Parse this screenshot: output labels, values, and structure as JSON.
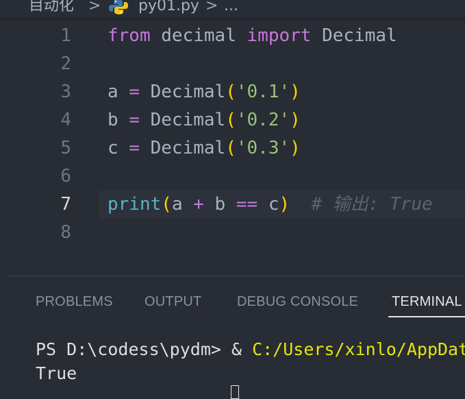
{
  "breadcrumb": {
    "folder": "目动化",
    "sep": ">",
    "file": "py01.py",
    "more": "..."
  },
  "editor": {
    "active_line": 7,
    "lines": [
      {
        "num": "1"
      },
      {
        "num": "2"
      },
      {
        "num": "3"
      },
      {
        "num": "4"
      },
      {
        "num": "5"
      },
      {
        "num": "6"
      },
      {
        "num": "7"
      },
      {
        "num": "8"
      }
    ],
    "tokens": {
      "l1_from": "from",
      "l1_mod": " decimal ",
      "l1_import": "import",
      "l1_cls": " Decimal",
      "l3_var": "a",
      "l4_var": "b",
      "l5_var": "c",
      "eq": " = ",
      "decimal": "Decimal",
      "lparen": "(",
      "rparen": ")",
      "l3_str": "'0.1'",
      "l4_str": "'0.2'",
      "l5_str": "'0.3'",
      "l7_print": "print",
      "l7_a": "a ",
      "l7_plus": "+",
      "l7_b": " b ",
      "l7_eqeq": "==",
      "l7_c": " c",
      "l7_comment": "  # 输出: True"
    }
  },
  "panel": {
    "tabs": [
      {
        "label": "PROBLEMS"
      },
      {
        "label": "OUTPUT"
      },
      {
        "label": "DEBUG CONSOLE"
      },
      {
        "label": "TERMINAL"
      }
    ],
    "active_tab": "TERMINAL"
  },
  "terminal": {
    "prompt": "PS D:\\codess\\pydm> & ",
    "path": "C:/Users/xinlo/AppData",
    "output": "True"
  },
  "colors": {
    "background": "#282c34",
    "keyword": "#c678dd",
    "string": "#98c379",
    "function": "#56b6c2",
    "bracket": "#ffd700",
    "comment": "#5c6370",
    "terminal_path": "#e5e510"
  }
}
